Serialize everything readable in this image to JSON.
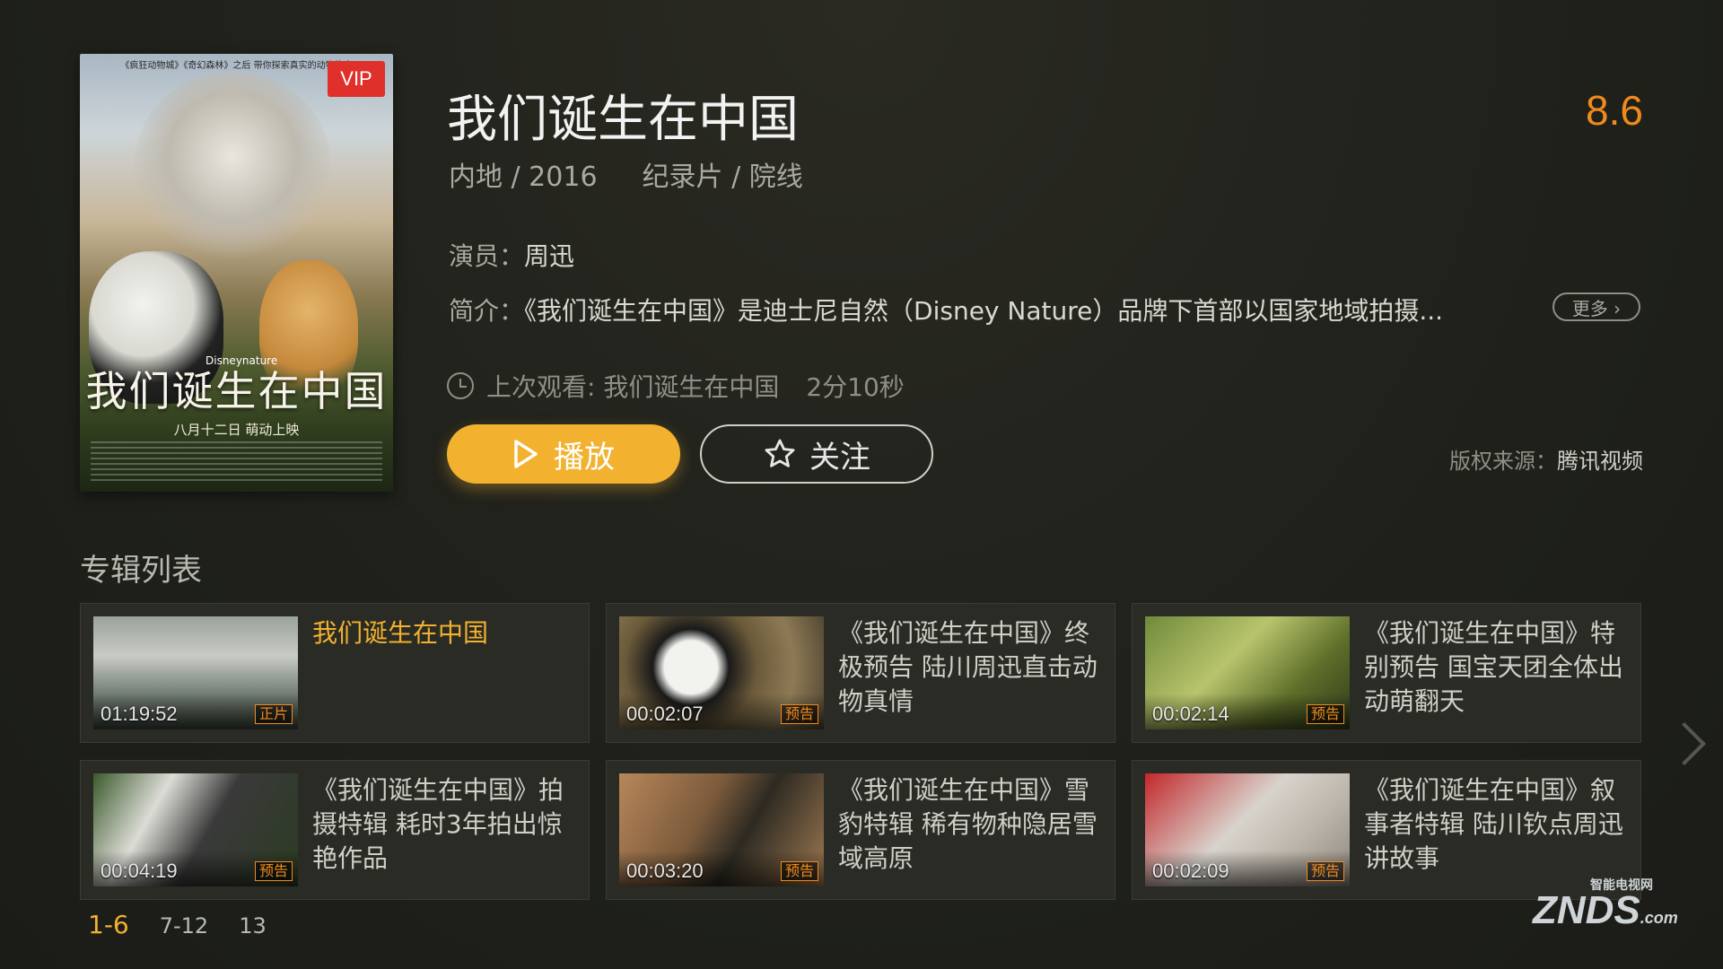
{
  "poster": {
    "tagline": "《疯狂动物城》《奇幻森林》之后 带你探索真实的动物故事",
    "brand": "Disneynature",
    "calligraphy": "我们诞生在中国",
    "release_date": "八月十二日 萌动上映",
    "vip_badge": "VIP"
  },
  "detail": {
    "title": "我们诞生在中国",
    "score": "8.6",
    "region_year": "内地 / 2016",
    "genre": "纪录片 / 院线",
    "cast_label": "演员：",
    "cast_value": "周迅",
    "intro_label": "简介：",
    "intro_value": "《我们诞生在中国》是迪士尼自然（Disney Nature）品牌下首部以国家地域拍摄...",
    "more_label": "更多 ›",
    "last_watch_label": "上次观看: 我们诞生在中国",
    "last_watch_time": "2分10秒",
    "play_label": "播放",
    "follow_label": "关注",
    "copyright_label": "版权来源：",
    "copyright_value": "腾讯视频"
  },
  "album": {
    "section_title": "专辑列表",
    "items": [
      {
        "title": "我们诞生在中国",
        "duration": "01:19:52",
        "badge": "正片",
        "active": true
      },
      {
        "title": "《我们诞生在中国》终极预告 陆川周迅直击动物真情",
        "duration": "00:02:07",
        "badge": "预告"
      },
      {
        "title": "《我们诞生在中国》特别预告 国宝天团全体出动萌翻天",
        "duration": "00:02:14",
        "badge": "预告"
      },
      {
        "title": "《我们诞生在中国》拍摄特辑 耗时3年拍出惊艳作品",
        "duration": "00:04:19",
        "badge": "预告"
      },
      {
        "title": "《我们诞生在中国》雪豹特辑 稀有物种隐居雪域高原",
        "duration": "00:03:20",
        "badge": "预告"
      },
      {
        "title": "《我们诞生在中国》叙事者特辑 陆川钦点周迅讲故事",
        "duration": "00:02:09",
        "badge": "预告"
      }
    ],
    "pages": [
      "1-6",
      "7-12",
      "13"
    ]
  },
  "watermark": {
    "main": "ZNDS",
    "small": "智能电视网",
    "suffix": ".com"
  }
}
